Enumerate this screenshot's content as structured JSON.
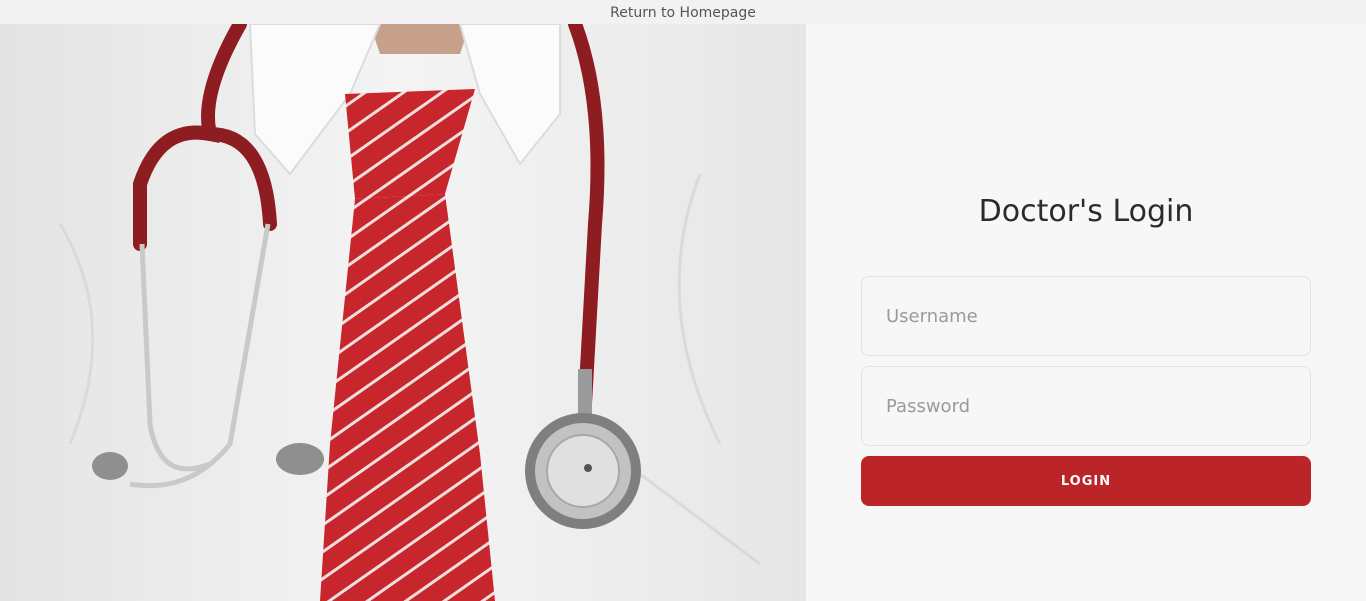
{
  "topbar": {
    "return_link": "Return to Homepage"
  },
  "hero": {
    "image": "doctor-white-shirt-red-tie-stethoscope"
  },
  "login": {
    "title": "Doctor's Login",
    "username_placeholder": "Username",
    "username_value": "",
    "password_placeholder": "Password",
    "password_value": "",
    "button_label": "LOGIN"
  },
  "colors": {
    "accent": "#bb2528",
    "panel_bg": "#f7f7f7",
    "topbar_bg": "#f2f2f2"
  }
}
